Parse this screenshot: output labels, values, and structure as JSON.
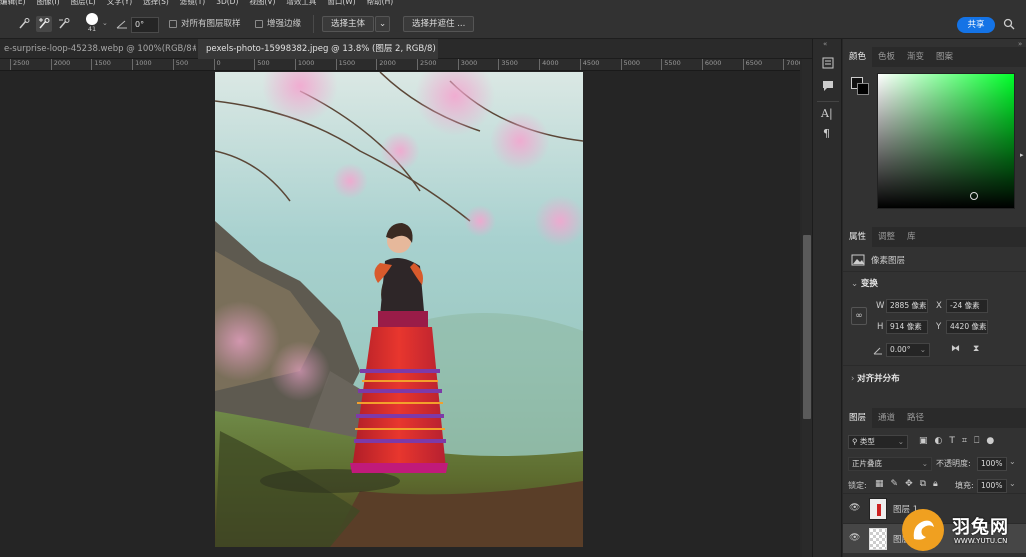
{
  "menu": [
    "编辑(E)",
    "图像(I)",
    "图层(L)",
    "文字(Y)",
    "选择(S)",
    "滤镜(T)",
    "3D(D)",
    "视图(V)",
    "增效工具",
    "窗口(W)",
    "帮助(H)"
  ],
  "options": {
    "brush_size": "41",
    "angle": "0°",
    "sample_all_layers": "对所有图层取样",
    "enhance_edge": "增强边缘",
    "select_subject": "选择主体",
    "select_and_mask": "选择并遮住 ...",
    "share": "共享"
  },
  "tabs": [
    {
      "label": "e-surprise-loop-45238.webp @ 100%(RGB/8#)",
      "close": "×",
      "active": false
    },
    {
      "label": "pexels-photo-15998382.jpeg @ 13.8% (图层 2, RGB/8) *",
      "close": "×",
      "active": true
    }
  ],
  "ruler": [
    "2500",
    "2000",
    "1500",
    "1000",
    "500",
    "0",
    "500",
    "1000",
    "1500",
    "2000",
    "2500",
    "3000",
    "3500",
    "4000",
    "4500",
    "5000",
    "5500",
    "6000",
    "6500",
    "7000"
  ],
  "color_panel": {
    "tabs": [
      "颜色",
      "色板",
      "渐变",
      "图案"
    ],
    "hue_color": "#00ff2a"
  },
  "properties": {
    "tabs": [
      "属性",
      "调整",
      "库"
    ],
    "layer_type": "像素图层",
    "transform_title": "变换",
    "w_label": "W",
    "w_value": "2885 像素",
    "h_label": "H",
    "h_value": "914 像素",
    "x_label": "X",
    "x_value": "-24 像素",
    "y_label": "Y",
    "y_value": "4420 像素",
    "angle_value": "0.00°",
    "align_title": "对齐并分布"
  },
  "layers": {
    "tabs": [
      "图层",
      "通道",
      "路径"
    ],
    "filter_kind": "类型",
    "blend_mode": "正片叠底",
    "opacity_label": "不透明度:",
    "opacity_value": "100%",
    "lock_label": "锁定:",
    "fill_label": "填充:",
    "fill_value": "100%",
    "items": [
      {
        "name": "图层 1"
      },
      {
        "name": "图层"
      }
    ]
  },
  "watermark": {
    "cn": "羽兔网",
    "url": "WWW.YUTU.CN"
  }
}
